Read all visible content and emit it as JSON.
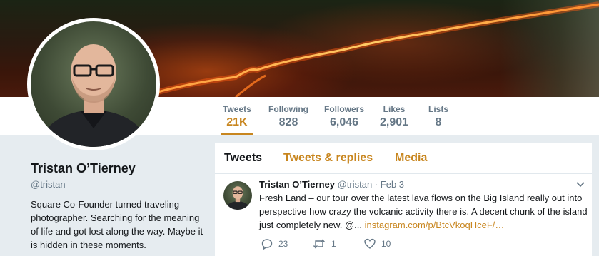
{
  "colors": {
    "accent": "#c8861f",
    "muted": "#657786",
    "text": "#14171a",
    "page_bg": "#e6ecf0"
  },
  "nav": {
    "stats": [
      {
        "label": "Tweets",
        "value": "21K",
        "active": true
      },
      {
        "label": "Following",
        "value": "828",
        "active": false
      },
      {
        "label": "Followers",
        "value": "6,046",
        "active": false
      },
      {
        "label": "Likes",
        "value": "2,901",
        "active": false
      },
      {
        "label": "Lists",
        "value": "8",
        "active": false
      }
    ]
  },
  "profile": {
    "name": "Tristan O’Tierney",
    "handle": "@tristan",
    "bio": "Square Co-Founder turned traveling photographer. Searching for the meaning of life and got lost along the way. Maybe it is hidden in these moments."
  },
  "timeline": {
    "tabs": [
      {
        "label": "Tweets",
        "active": true
      },
      {
        "label": "Tweets & replies",
        "active": false
      },
      {
        "label": "Media",
        "active": false
      }
    ],
    "tweet": {
      "name": "Tristan O’Tierney",
      "handle": "@tristan",
      "separator": "·",
      "date": "Feb 3",
      "text": "Fresh Land – our tour over the latest lava flows on the Big Island really out into perspective how crazy the volcanic activity there is. A decent chunk of the island just completely new. @...",
      "link": "instagram.com/p/BtcVkoqHceF/…",
      "replies": "23",
      "retweets": "1",
      "likes": "10"
    }
  },
  "icons": {
    "caret": "chevron-down-icon",
    "reply": "reply-icon",
    "retweet": "retweet-icon",
    "like": "heart-icon"
  }
}
